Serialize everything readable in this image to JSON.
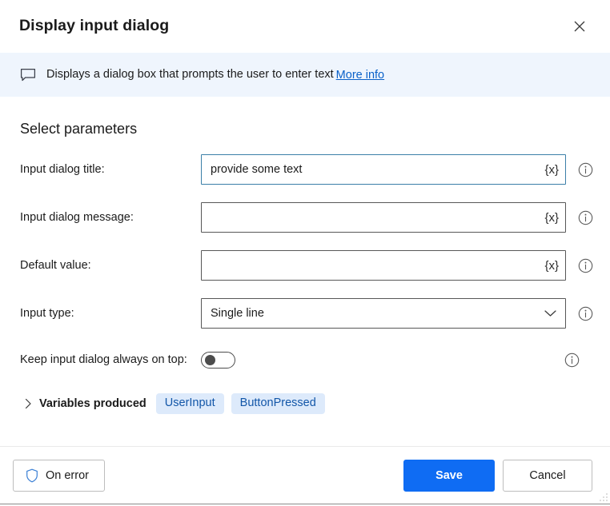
{
  "titlebar": {
    "title": "Display input dialog",
    "close_icon": "close-icon"
  },
  "banner": {
    "icon": "comment-bubble-icon",
    "text": "Displays a dialog box that prompts the user to enter text",
    "link_label": "More info"
  },
  "params": {
    "section_title": "Select parameters",
    "fields": [
      {
        "label": "Input dialog title:",
        "value": "provide some text",
        "placeholder": "",
        "token": "{x}",
        "focused": true,
        "info_icon": "info-icon"
      },
      {
        "label": "Input dialog message:",
        "value": "",
        "placeholder": "",
        "token": "{x}",
        "focused": false,
        "info_icon": "info-icon"
      },
      {
        "label": "Default value:",
        "value": "",
        "placeholder": "",
        "token": "{x}",
        "focused": false,
        "info_icon": "info-icon"
      }
    ],
    "dropdown": {
      "label": "Input type:",
      "value": "Single line",
      "chevron_icon": "chevron-down-icon",
      "info_icon": "info-icon"
    },
    "toggle": {
      "label": "Keep input dialog always on top:",
      "state": "off",
      "info_icon": "info-icon"
    }
  },
  "variables": {
    "chevron_icon": "chevron-right-icon",
    "title": "Variables produced",
    "pills": [
      "UserInput",
      "ButtonPressed"
    ]
  },
  "footer": {
    "on_error_label": "On error",
    "on_error_icon": "shield-icon",
    "save_label": "Save",
    "cancel_label": "Cancel"
  },
  "colors": {
    "accent_blue": "#0f6cf3",
    "link_blue": "#0a61c9",
    "banner_bg": "#eff5fd",
    "pill_bg": "#ddeafb",
    "pill_text": "#1256a8",
    "focus_border": "#3b7fa8",
    "field_border": "#575757"
  }
}
